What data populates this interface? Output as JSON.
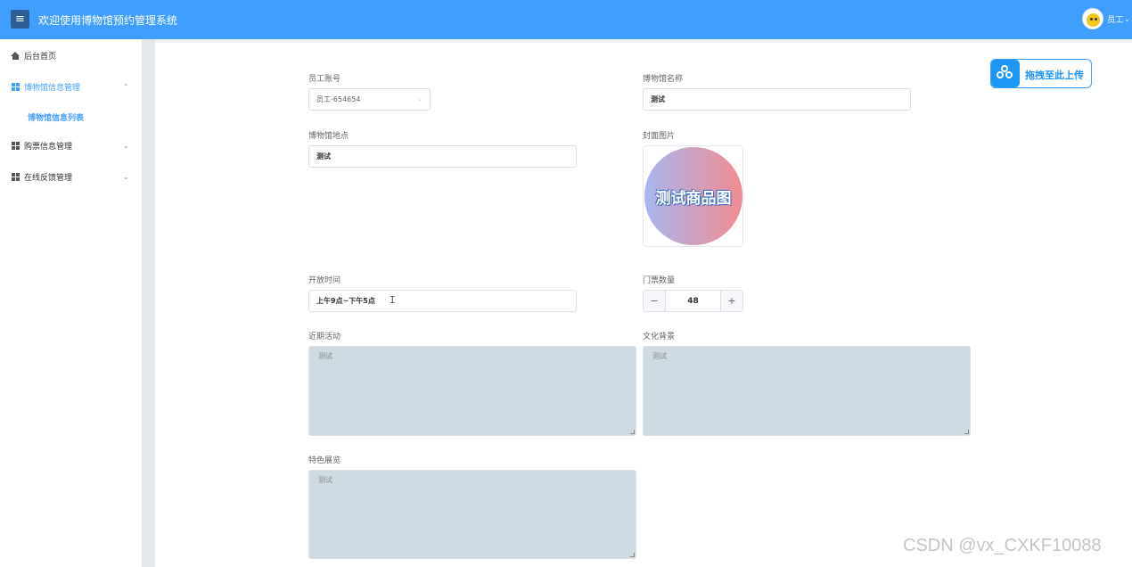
{
  "header": {
    "menu_icon": "hamburger-icon",
    "title": "欢迎使用博物馆预约管理系统",
    "user_name": "员工",
    "user_caret": "⌄",
    "colors": {
      "topbar": "#409eff"
    }
  },
  "sidebar": {
    "items": [
      {
        "label": "后台首页",
        "icon": "home-icon"
      },
      {
        "label": "博物馆信息管理",
        "icon": "grid-icon",
        "caret": "⌃",
        "active": true
      },
      {
        "label": "博物馆信息列表",
        "submenu": true
      },
      {
        "label": "购票信息管理",
        "icon": "grid-icon",
        "caret": "⌄"
      },
      {
        "label": "在线反馈管理",
        "icon": "grid-icon",
        "caret": "⌄"
      }
    ]
  },
  "form": {
    "staff_account": {
      "label": "员工账号",
      "value": "员工-654654"
    },
    "museum_name": {
      "label": "博物馆名称",
      "value": "测试"
    },
    "museum_location": {
      "label": "博物馆地点",
      "value": "测试"
    },
    "cover_image": {
      "label": "封面图片",
      "image_text": "测试商品图"
    },
    "opening_hours": {
      "label": "开放时间",
      "value": "上午9点~下午5点"
    },
    "ticket_count": {
      "label": "门票数量",
      "value": "48",
      "minus": "−",
      "plus": "+"
    },
    "recent_activities": {
      "label": "近期活动",
      "value": "测试"
    },
    "cultural_background": {
      "label": "文化背景",
      "value": "测试"
    },
    "featured_exhibition": {
      "label": "特色展览",
      "value": "测试"
    }
  },
  "upload": {
    "label": "拖拽至此上传",
    "icon": "cloud-upload-icon"
  },
  "cursor": "I",
  "watermark": "CSDN @vx_CXKF10088"
}
